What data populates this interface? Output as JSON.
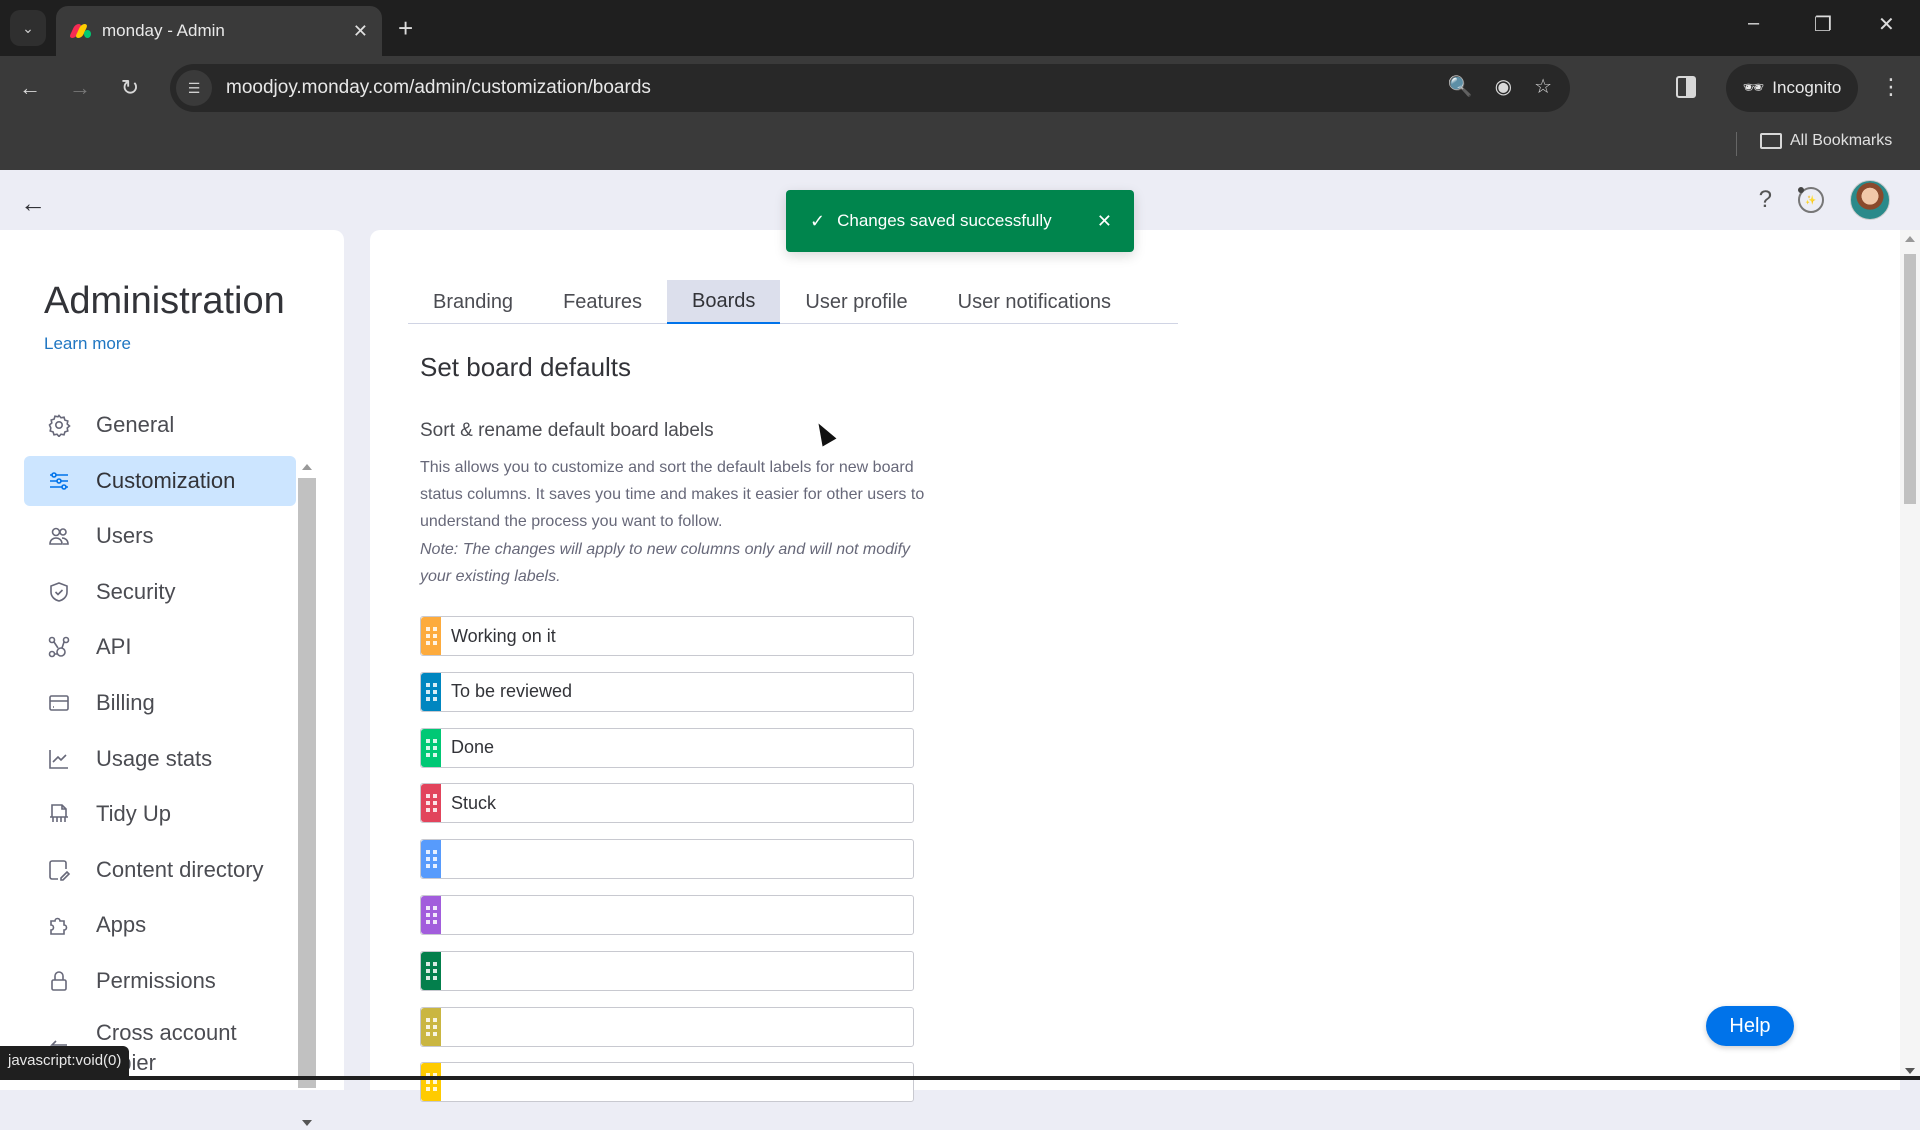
{
  "browser": {
    "tab_title": "monday - Admin",
    "url": "moodjoy.monday.com/admin/customization/boards",
    "incognito_label": "Incognito",
    "all_bookmarks_label": "All Bookmarks",
    "status_tooltip": "javascript:void(0)"
  },
  "toast": {
    "message": "Changes saved successfully",
    "color": "#00854d"
  },
  "sidebar": {
    "title": "Administration",
    "learn_more": "Learn more",
    "items": [
      {
        "label": "General",
        "icon": "gear-icon"
      },
      {
        "label": "Customization",
        "icon": "sliders-icon",
        "active": true
      },
      {
        "label": "Users",
        "icon": "users-icon"
      },
      {
        "label": "Security",
        "icon": "shield-icon"
      },
      {
        "label": "API",
        "icon": "api-icon"
      },
      {
        "label": "Billing",
        "icon": "credit-card-icon"
      },
      {
        "label": "Usage stats",
        "icon": "chart-icon"
      },
      {
        "label": "Tidy Up",
        "icon": "shredder-icon"
      },
      {
        "label": "Content directory",
        "icon": "content-directory-icon"
      },
      {
        "label": "Apps",
        "icon": "puzzle-icon"
      },
      {
        "label": "Permissions",
        "icon": "lock-icon"
      },
      {
        "label": "Cross account copier",
        "icon": "cross-account-icon"
      }
    ]
  },
  "main": {
    "tabs": [
      {
        "label": "Branding"
      },
      {
        "label": "Features"
      },
      {
        "label": "Boards",
        "active": true
      },
      {
        "label": "User profile"
      },
      {
        "label": "User notifications"
      }
    ],
    "section_title": "Set board defaults",
    "subsection_title": "Sort & rename default board labels",
    "description": "This allows you to customize and sort the default labels for new board status columns. It saves you time and makes it easier for other users to understand the process you want to follow.",
    "note": "Note: The changes will apply to new columns only and will not modify your existing labels.",
    "labels": [
      {
        "value": "Working on it",
        "color": "#fdab3d"
      },
      {
        "value": "To be reviewed",
        "color": "#0086c0"
      },
      {
        "value": "Done",
        "color": "#00c875"
      },
      {
        "value": "Stuck",
        "color": "#e2445c"
      },
      {
        "value": "",
        "color": "#579bfc"
      },
      {
        "value": "",
        "color": "#a25ddc"
      },
      {
        "value": "",
        "color": "#037f4c"
      },
      {
        "value": "",
        "color": "#cab641"
      },
      {
        "value": "",
        "color": "#ffcb00"
      }
    ]
  },
  "help_button": "Help"
}
